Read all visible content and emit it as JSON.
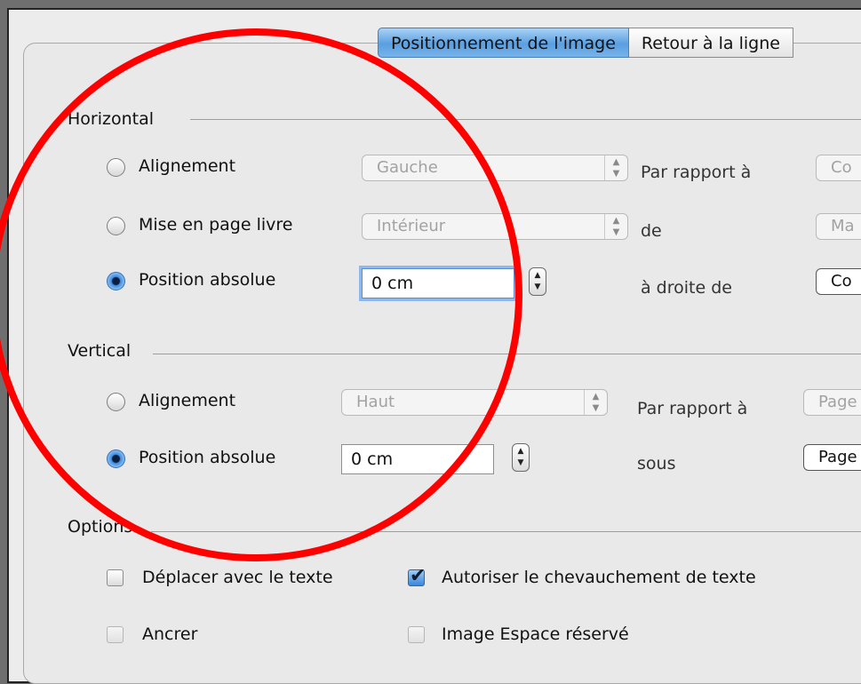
{
  "tabs": [
    "Positionnement de l'image",
    "Retour à la ligne"
  ],
  "horizontal": {
    "heading": "Horizontal",
    "alignement": {
      "label": "Alignement",
      "select": "Gauche",
      "relation": "Par rapport à",
      "target": "Co"
    },
    "mise_en_page": {
      "label": "Mise en page livre",
      "select": "Intérieur",
      "relation": "de",
      "target": "Ma"
    },
    "absolue": {
      "label": "Position absolue",
      "value": "0 cm",
      "relation": "à droite de",
      "target": "Co"
    }
  },
  "vertical": {
    "heading": "Vertical",
    "alignement": {
      "label": "Alignement",
      "select": "Haut",
      "relation": "Par rapport à",
      "target": "Page"
    },
    "absolue": {
      "label": "Position absolue",
      "value": "0 cm",
      "relation": "sous",
      "target": "Page"
    }
  },
  "options": {
    "heading": "Options",
    "deplacer": "Déplacer avec le texte",
    "chevauchement": "Autoriser le chevauchement de texte",
    "ancrer": "Ancrer",
    "espace": "Image Espace réservé"
  },
  "annotation_color": "#ff0000"
}
